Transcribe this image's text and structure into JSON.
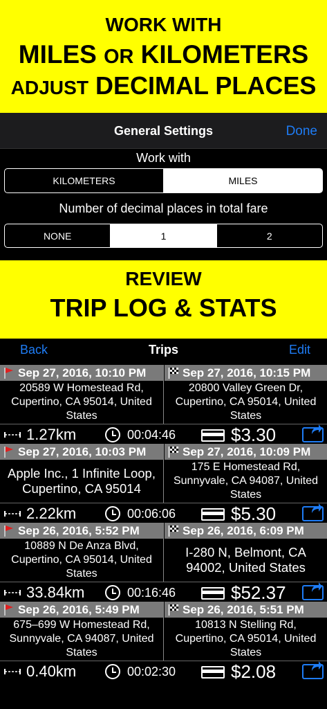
{
  "banner_top": {
    "line1": "WORK WITH",
    "line2_a": "MILES",
    "line2_b": "OR",
    "line2_c": "KILOMETERS",
    "line3_a": "ADJUST",
    "line3_b": "DECIMAL PLACES"
  },
  "settings": {
    "title": "General Settings",
    "done_label": "Done",
    "work_with_label": "Work with",
    "units": [
      "KILOMETERS",
      "MILES"
    ],
    "units_selected": "MILES",
    "decimal_label": "Number of decimal places in total fare",
    "decimals": [
      "NONE",
      "1",
      "2"
    ],
    "decimals_selected": "1"
  },
  "banner_mid": {
    "line1": "REVIEW",
    "line2": "TRIP LOG & STATS"
  },
  "trips": {
    "back_label": "Back",
    "title": "Trips",
    "edit_label": "Edit",
    "items": [
      {
        "start_time": "Sep 27, 2016, 10:10 PM",
        "end_time": "Sep 27, 2016, 10:15 PM",
        "start_addr": [
          "20589 W Homestead Rd,",
          "Cupertino, CA  95014, United",
          "States"
        ],
        "end_addr": [
          "20800 Valley Green Dr,",
          "Cupertino, CA  95014, United",
          "States"
        ],
        "distance": "1.27km",
        "duration": "00:04:46",
        "fare": "$3.30"
      },
      {
        "start_time": "Sep 27, 2016, 10:03 PM",
        "end_time": "Sep 27, 2016, 10:09 PM",
        "start_addr": [
          "Apple Inc., 1 Infinite Loop,",
          "Cupertino, CA  95014"
        ],
        "end_addr": [
          "175 E Homestead Rd,",
          "Sunnyvale, CA  94087, United",
          "States"
        ],
        "distance": "2.22km",
        "duration": "00:06:06",
        "fare": "$5.30"
      },
      {
        "start_time": "Sep 26, 2016, 5:52 PM",
        "end_time": "Sep 26, 2016, 6:09 PM",
        "start_addr": [
          "10889 N De Anza Blvd,",
          "Cupertino, CA  95014, United",
          "States"
        ],
        "end_addr": [
          "I-280 N, Belmont, CA",
          "94002, United States"
        ],
        "distance": "33.84km",
        "duration": "00:16:46",
        "fare": "$52.37"
      },
      {
        "start_time": "Sep 26, 2016, 5:49 PM",
        "end_time": "Sep 26, 2016, 5:51 PM",
        "start_addr": [
          "675–699 W Homestead Rd,",
          "Sunnyvale, CA  94087, United",
          "States"
        ],
        "end_addr": [
          "10813 N Stelling Rd,",
          "Cupertino, CA  95014, United",
          "States"
        ],
        "distance": "0.40km",
        "duration": "00:02:30",
        "fare": "$2.08"
      }
    ]
  },
  "colors": {
    "banner": "#ffff00",
    "accent": "#1e7cf5",
    "header_gray": "#7a7a7a"
  },
  "icons": [
    "red-flag-icon",
    "checkered-flag-icon",
    "distance-icon",
    "clock-icon",
    "card-icon",
    "share-icon"
  ]
}
